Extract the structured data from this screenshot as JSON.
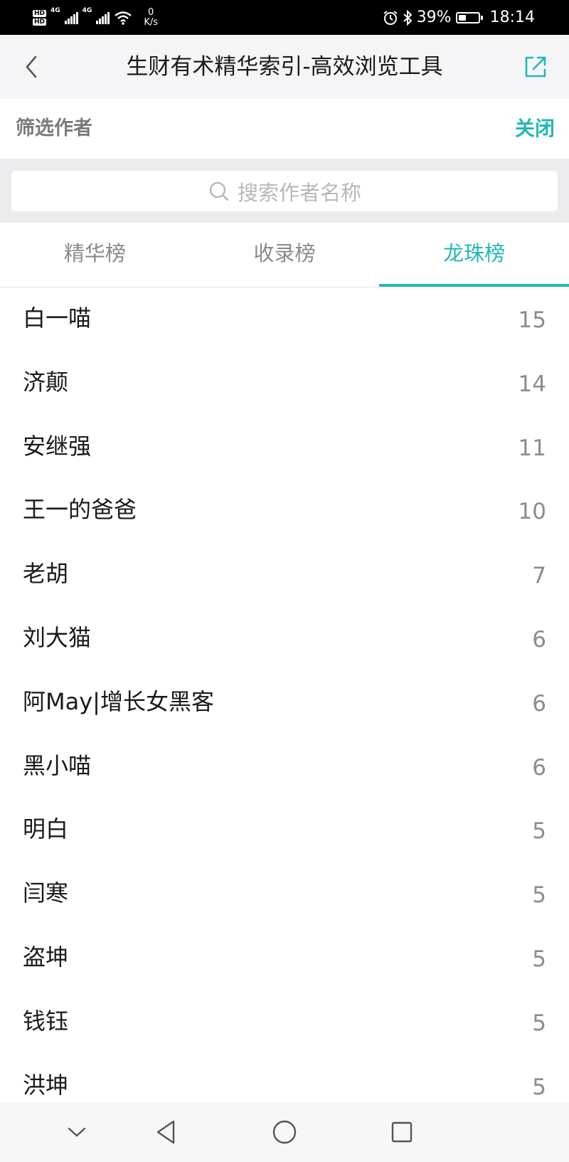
{
  "status_bar": {
    "hd1": "HD",
    "hd2": "HD",
    "net1": "4G",
    "net2": "4G",
    "speed_value": "0",
    "speed_unit": "K/s",
    "battery_text": "39%",
    "battery_level": 0.39,
    "time": "18:14"
  },
  "header": {
    "title": "生财有术精华索引-高效浏览工具"
  },
  "filter": {
    "title": "筛选作者",
    "close_label": "关闭"
  },
  "search": {
    "placeholder": "搜索作者名称"
  },
  "tabs": [
    {
      "label": "精华榜",
      "active": false
    },
    {
      "label": "收录榜",
      "active": false
    },
    {
      "label": "龙珠榜",
      "active": true
    }
  ],
  "authors": [
    {
      "name": "白一喵",
      "count": "15"
    },
    {
      "name": "济颠",
      "count": "14"
    },
    {
      "name": "安继强",
      "count": "11"
    },
    {
      "name": "王一的爸爸",
      "count": "10"
    },
    {
      "name": "老胡",
      "count": "7"
    },
    {
      "name": "刘大猫",
      "count": "6"
    },
    {
      "name": "阿May|增长女黑客",
      "count": "6"
    },
    {
      "name": "黑小喵",
      "count": "6"
    },
    {
      "name": "明白",
      "count": "5"
    },
    {
      "name": "闫寒",
      "count": "5"
    },
    {
      "name": "盗坤",
      "count": "5"
    },
    {
      "name": "钱钰",
      "count": "5"
    },
    {
      "name": "洪坤",
      "count": "5"
    }
  ],
  "colors": {
    "accent": "#22b8b6",
    "status_bar_bg": "#000000",
    "title_bar_bg": "#f5f5f7"
  },
  "icons": {
    "back": "chevron-left-icon",
    "share": "external-link-icon",
    "search": "search-icon",
    "nav_down": "chevron-down-icon",
    "nav_back": "triangle-back-icon",
    "nav_home": "circle-home-icon",
    "nav_recent": "square-recent-icon"
  }
}
